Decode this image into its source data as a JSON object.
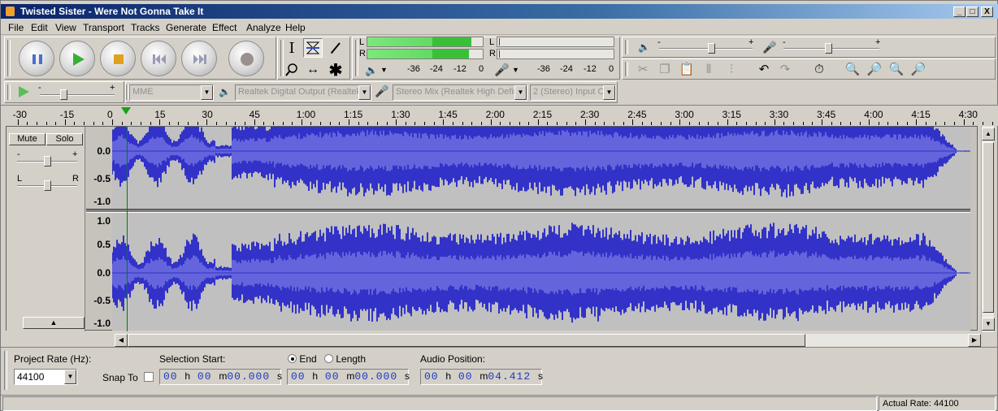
{
  "window": {
    "title": "Twisted Sister - Were Not Gonna Take It",
    "min_glyph": "_",
    "max_glyph": "□",
    "close_glyph": "X"
  },
  "menu": [
    "File",
    "Edit",
    "View",
    "Transport",
    "Tracks",
    "Generate",
    "Effect",
    "Analyze",
    "Help"
  ],
  "meters": {
    "left_label": "L",
    "right_label": "R",
    "scale": [
      "-36",
      "-24",
      "-12",
      "0"
    ],
    "playback_scale": [
      "-36",
      "-24",
      "-12",
      "0"
    ],
    "left_level": 0.85,
    "right_level": 0.83
  },
  "device": {
    "host": "MME",
    "output": "Realtek Digital Output (Realtek",
    "input": "Stereo Mix (Realtek High Defin",
    "channels": "2 (Stereo) Input C"
  },
  "timeline": {
    "labels": [
      "-30",
      "-15",
      "0",
      "15",
      "30",
      "45",
      "1:00",
      "1:15",
      "1:30",
      "1:45",
      "2:00",
      "2:15",
      "2:30",
      "2:45",
      "3:00",
      "3:15",
      "3:30",
      "3:45",
      "4:00",
      "4:15",
      "4:30"
    ],
    "playhead_seconds": 4.412
  },
  "track": {
    "name_partial": "",
    "mute": "Mute",
    "solo": "Solo",
    "gain_minus": "-",
    "gain_plus": "+",
    "pan_left": "L",
    "pan_right": "R",
    "channel1_ruler": [
      "0.0",
      "-0.5",
      "-1.0"
    ],
    "channel2_ruler": [
      "1.0",
      "0.5",
      "0.0",
      "-0.5",
      "-1.0"
    ]
  },
  "selection": {
    "project_rate_label": "Project Rate (Hz):",
    "project_rate": "44100",
    "snap_to_label": "Snap To",
    "selection_start_label": "Selection Start:",
    "end_label": "End",
    "length_label": "Length",
    "audio_position_label": "Audio Position:",
    "selection_start": {
      "h": "00",
      "m": "00",
      "s": "00.000"
    },
    "selection_end": {
      "h": "00",
      "m": "00",
      "s": "00.000"
    },
    "audio_position": {
      "h": "00",
      "m": "00",
      "s": "04.412"
    },
    "unit_h": "h",
    "unit_m": "m",
    "unit_s": "s"
  },
  "status": {
    "actual_rate": "Actual Rate: 44100"
  },
  "colors": {
    "wave": "#3232c8",
    "wave_rms": "#6464dc",
    "wave_bg": "#c0c0c0"
  }
}
